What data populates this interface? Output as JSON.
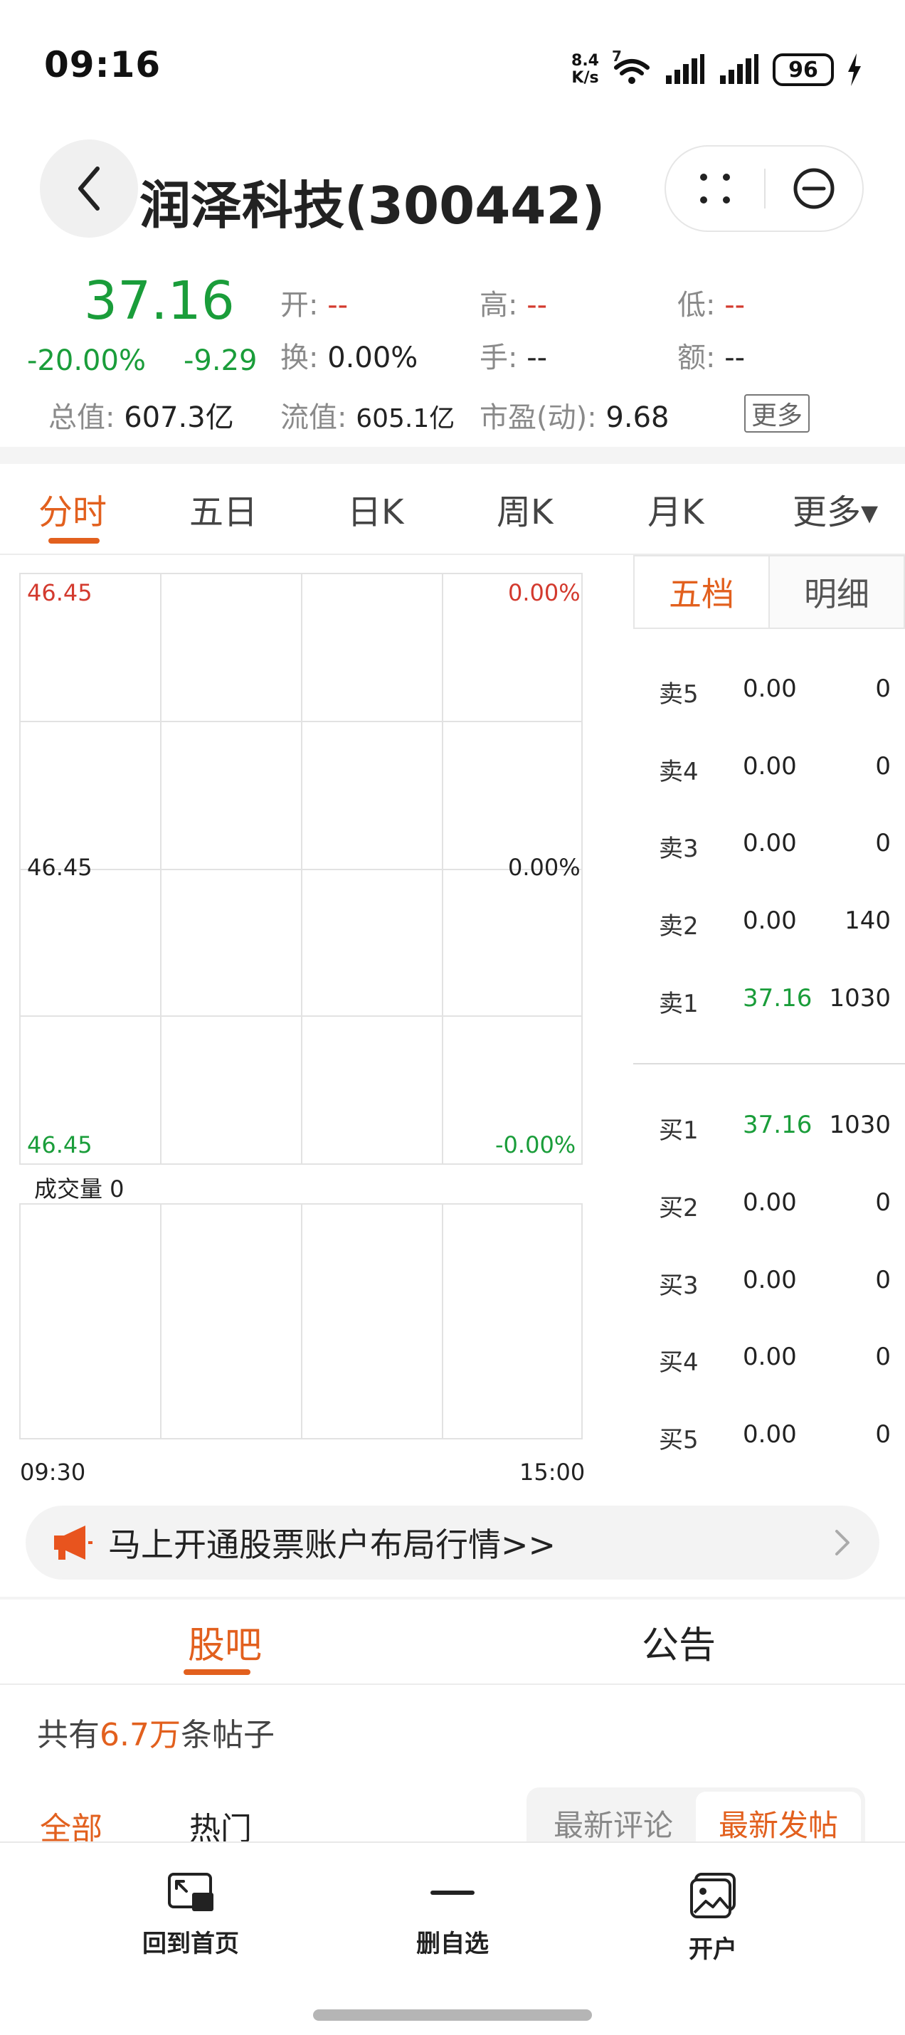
{
  "status_bar": {
    "time": "09:16",
    "net_speed_value": "8.4",
    "net_speed_unit": "K/s",
    "wifi_badge": "7",
    "battery": "96"
  },
  "header": {
    "title": "润泽科技(300442)"
  },
  "quote": {
    "price": "37.16",
    "change_pct": "-20.00%",
    "change_value": "-9.29",
    "open_label": "开:",
    "open_value": "--",
    "high_label": "高:",
    "high_value": "--",
    "low_label": "低:",
    "low_value": "--",
    "turnover_label": "换:",
    "turnover_value": "0.00%",
    "hands_label": "手:",
    "hands_value": "--",
    "amount_label": "额:",
    "amount_value": "--",
    "total_cap_label": "总值:",
    "total_cap_value": "607.3亿",
    "float_cap_label": "流值:",
    "float_cap_value": "605.1亿",
    "pe_label": "市盈(动):",
    "pe_value": "9.68",
    "more_label": "更多"
  },
  "chart_tabs": [
    "分时",
    "五日",
    "日K",
    "周K",
    "月K",
    "更多▾"
  ],
  "chart": {
    "top_left": "46.45",
    "top_right": "0.00%",
    "mid_left": "46.45",
    "mid_right": "0.00%",
    "bottom_left": "46.45",
    "bottom_right": "-0.00%",
    "volume_label": "成交量 0",
    "time_start": "09:30",
    "time_end": "15:00"
  },
  "order_book": {
    "tabs": [
      "五档",
      "明细"
    ],
    "sell": [
      {
        "name": "卖5",
        "price": "0.00",
        "volume": "0"
      },
      {
        "name": "卖4",
        "price": "0.00",
        "volume": "0"
      },
      {
        "name": "卖3",
        "price": "0.00",
        "volume": "0"
      },
      {
        "name": "卖2",
        "price": "0.00",
        "volume": "140"
      },
      {
        "name": "卖1",
        "price": "37.16",
        "volume": "1030"
      }
    ],
    "buy": [
      {
        "name": "买1",
        "price": "37.16",
        "volume": "1030"
      },
      {
        "name": "买2",
        "price": "0.00",
        "volume": "0"
      },
      {
        "name": "买3",
        "price": "0.00",
        "volume": "0"
      },
      {
        "name": "买4",
        "price": "0.00",
        "volume": "0"
      },
      {
        "name": "买5",
        "price": "0.00",
        "volume": "0"
      }
    ]
  },
  "banner": {
    "text": "马上开通股票账户布局行情>>"
  },
  "sections": {
    "tabs": [
      "股吧",
      "公告"
    ]
  },
  "posts": {
    "count_prefix": "共有",
    "count_value": "6.7万",
    "count_suffix": "条帖子",
    "filters": [
      "全部",
      "热门"
    ],
    "sort_options": [
      "最新评论",
      "最新发帖"
    ]
  },
  "bottom_nav": {
    "items": [
      "回到首页",
      "删自选",
      "开户"
    ]
  },
  "colors": {
    "accent": "#e2601e",
    "down_green": "#1a9d3a",
    "up_red": "#d33a2e"
  }
}
